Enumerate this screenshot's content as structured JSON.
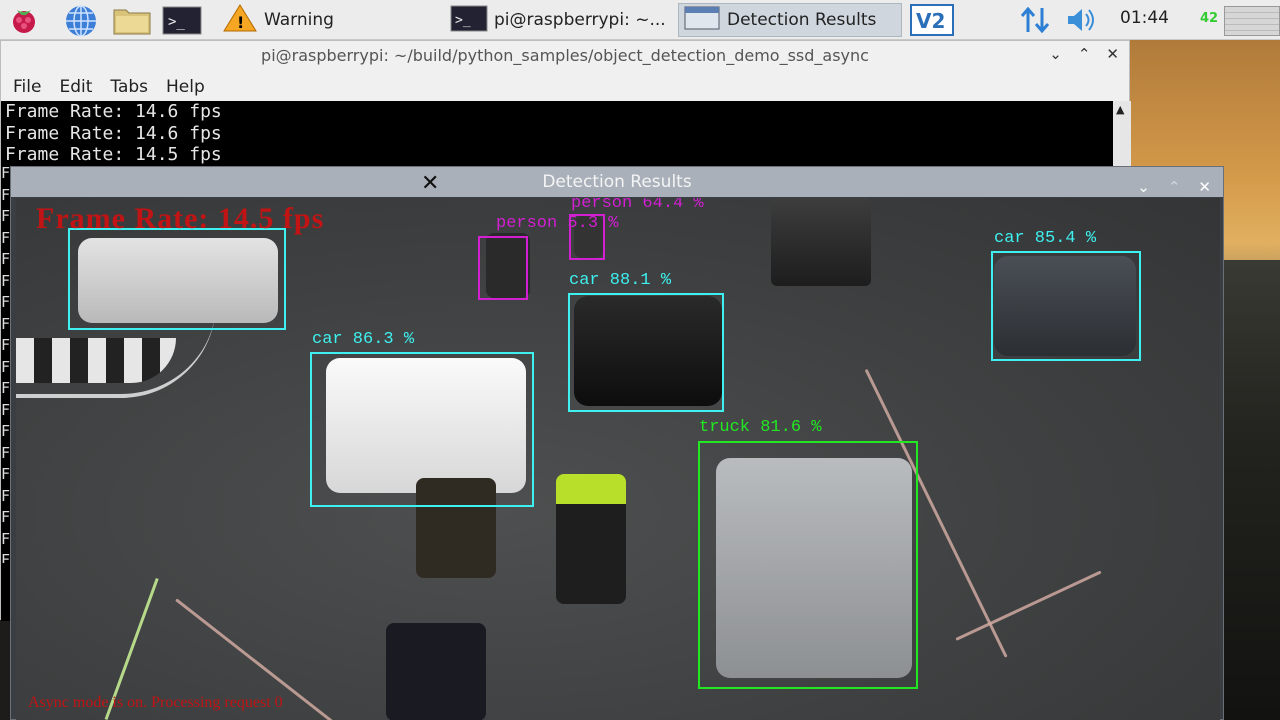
{
  "taskbar": {
    "warning_label": "Warning",
    "terminal_task_label": "pi@raspberrypi: ~...",
    "detection_task_label": "Detection Results",
    "clock": "01:44",
    "cpu_percent": "42",
    "icons": [
      "raspberry-menu-icon",
      "web-browser-icon",
      "file-manager-icon",
      "terminal-icon",
      "warning-icon",
      "vnc-icon",
      "network-icon",
      "volume-icon",
      "cpu-monitor-icon"
    ]
  },
  "terminal": {
    "title": "pi@raspberrypi: ~/build/python_samples/object_detection_demo_ssd_async",
    "menu": [
      "File",
      "Edit",
      "Tabs",
      "Help"
    ],
    "lines": [
      "Frame Rate: 14.6 fps",
      "Frame Rate: 14.6 fps",
      "Frame Rate: 14.5 fps"
    ],
    "left_column_char": "F"
  },
  "detection_window": {
    "title": "Detection Results",
    "overlay_frame_rate": "Frame Rate: 14.5 fps",
    "overlay_async": "Async mode is on. Processing request 0",
    "detections": [
      {
        "label": "car",
        "score": "car 86.3 %",
        "color": "#3ef0ef"
      },
      {
        "label": "car",
        "score": "car 88.1 %",
        "color": "#3ef0ef"
      },
      {
        "label": "car",
        "score": "car 85.4 %",
        "color": "#3ef0ef"
      },
      {
        "label": "truck",
        "score": "truck 81.6 %",
        "color": "#22e822"
      },
      {
        "label": "person",
        "score": "person 64.4 %",
        "color": "#d21fd2"
      },
      {
        "label": "person",
        "score": "person 5.3 %",
        "color": "#d21fd2"
      },
      {
        "label": "car",
        "score": "",
        "color": "#3ef0ef"
      }
    ]
  }
}
